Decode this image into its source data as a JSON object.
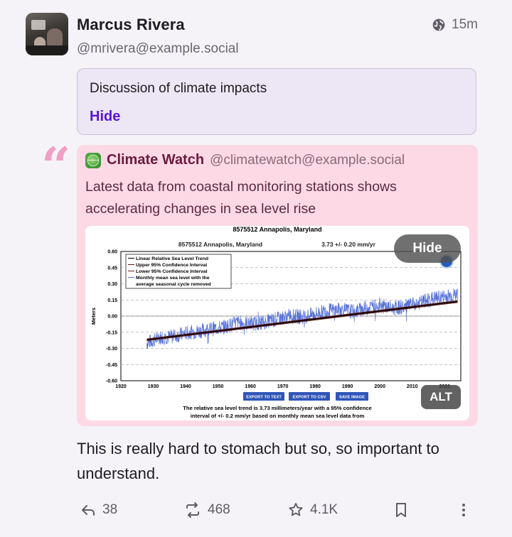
{
  "post": {
    "author_name": "Marcus Rivera",
    "author_handle": "@mrivera@example.social",
    "visibility_icon": "globe-icon",
    "time": "15m",
    "content_warning": {
      "text": "Discussion of climate impacts",
      "toggle_label": "Hide"
    },
    "quote": {
      "mark": "“",
      "author_name": "Climate Watch",
      "author_handle": "@climatewatch@example.social",
      "text": "Latest data from coastal monitoring stations shows accelerating changes in sea level rise",
      "media": {
        "hide_label": "Hide",
        "alt_label": "ALT"
      }
    },
    "body": "This is really hard to stomach but so, so important to understand.",
    "actions": {
      "replies": "38",
      "boosts": "468",
      "favorites": "4.1K"
    }
  },
  "chart_data": {
    "type": "line",
    "title": "8575512 Annapolis, Maryland",
    "subtitle_station": "8575512 Annapolis, Maryland",
    "subtitle_trend": "3.73 +/-  0.20 mm/yr",
    "ylabel": "Meters",
    "xlabel": "",
    "xlim": [
      1920,
      2025
    ],
    "ylim": [
      -0.6,
      0.6
    ],
    "x_ticks": [
      "1920",
      "1930",
      "1940",
      "1950",
      "1960",
      "1970",
      "1980",
      "1990",
      "2000",
      "2010",
      "2020"
    ],
    "y_ticks": [
      "0.60",
      "0.45",
      "0.30",
      "0.15",
      "0.00",
      "-0.15",
      "-0.30",
      "-0.45",
      "-0.60"
    ],
    "legend": [
      "Linear Relative Sea Level Trend",
      "Upper 95% Confidence Interval",
      "Lower 95% Confidence Interval",
      "Monthly mean sea level with the",
      "average seasonal cycle removed"
    ],
    "legend_position": "top-left",
    "trend": {
      "x": [
        1928,
        2024
      ],
      "y": [
        -0.22,
        0.135
      ]
    },
    "series": [
      {
        "name": "Monthly mean sea level with the average seasonal cycle removed",
        "x": [
          1928,
          1932,
          1936,
          1940,
          1944,
          1948,
          1952,
          1956,
          1960,
          1964,
          1968,
          1972,
          1976,
          1980,
          1984,
          1988,
          1992,
          1996,
          2000,
          2004,
          2008,
          2012,
          2016,
          2020,
          2024
        ],
        "y": [
          -0.25,
          -0.2,
          -0.19,
          -0.16,
          -0.14,
          -0.12,
          -0.1,
          -0.06,
          -0.07,
          -0.06,
          -0.03,
          0.0,
          -0.01,
          0.02,
          0.05,
          0.06,
          0.04,
          0.08,
          0.1,
          0.07,
          0.09,
          0.12,
          0.16,
          0.18,
          0.2
        ]
      }
    ],
    "buttons": [
      "EXPORT TO TEXT",
      "EXPORT TO CSV",
      "SAVE IMAGE"
    ],
    "caption": [
      "The relative sea level trend is 3.73 millimeters/year with a 95% confidence",
      "interval of +/- 0.2 mm/yr based on monthly mean sea level data from"
    ],
    "grid": true
  }
}
